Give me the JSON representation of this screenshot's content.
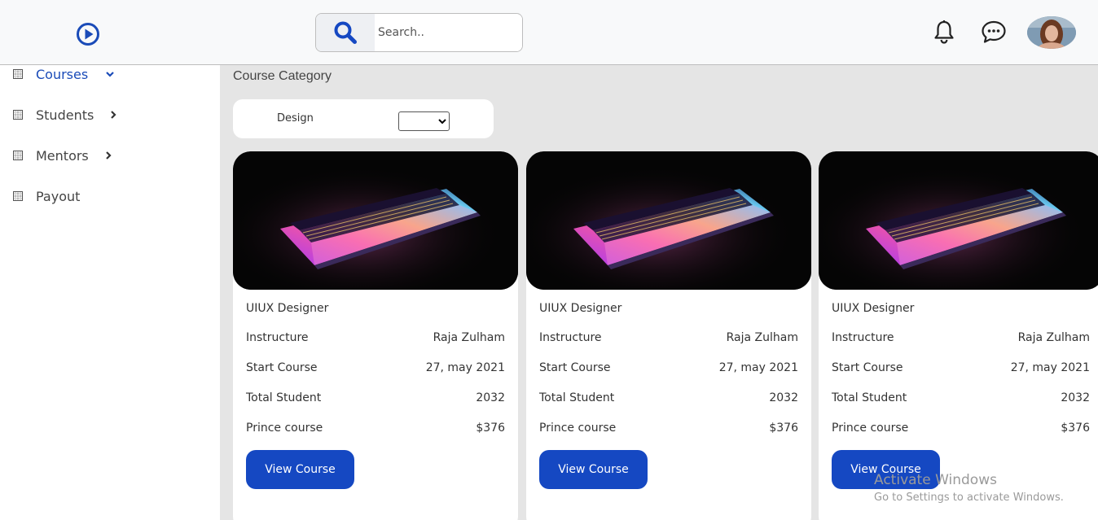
{
  "header": {
    "search_placeholder": "Search..",
    "icons": [
      "play-circle-icon",
      "search-icon",
      "bell-icon",
      "chat-icon"
    ]
  },
  "sidebar": {
    "items": [
      {
        "label": "Courses",
        "active": true
      },
      {
        "label": "Students",
        "active": false
      },
      {
        "label": "Mentors",
        "active": false
      },
      {
        "label": "Payout",
        "active": false
      }
    ]
  },
  "main": {
    "category_title": "Course Category",
    "filter": {
      "label": "Design",
      "selected": ""
    }
  },
  "cards": [
    {
      "title": "UIUX Designer",
      "rows": [
        {
          "label": "Instructure",
          "value": "Raja Zulham"
        },
        {
          "label": "Start Course",
          "value": "27, may 2021"
        },
        {
          "label": "Total Student",
          "value": "2032"
        },
        {
          "label": "Prince course",
          "value": "$376"
        }
      ],
      "button": "View Course"
    },
    {
      "title": "UIUX Designer",
      "rows": [
        {
          "label": "Instructure",
          "value": "Raja Zulham"
        },
        {
          "label": "Start Course",
          "value": "27, may 2021"
        },
        {
          "label": "Total Student",
          "value": "2032"
        },
        {
          "label": "Prince course",
          "value": "$376"
        }
      ],
      "button": "View Course"
    },
    {
      "title": "UIUX Designer",
      "rows": [
        {
          "label": "Instructure",
          "value": "Raja Zulham"
        },
        {
          "label": "Start Course",
          "value": "27, may 2021"
        },
        {
          "label": "Total Student",
          "value": "2032"
        },
        {
          "label": "Prince course",
          "value": "$376"
        }
      ],
      "button": "View Course"
    }
  ],
  "watermark": {
    "line1": "Activate Windows",
    "line2": "Go to Settings to activate Windows."
  },
  "colors": {
    "accent": "#1548c2",
    "nav_active": "#1a4bb8",
    "main_bg": "#e5e5e5"
  }
}
